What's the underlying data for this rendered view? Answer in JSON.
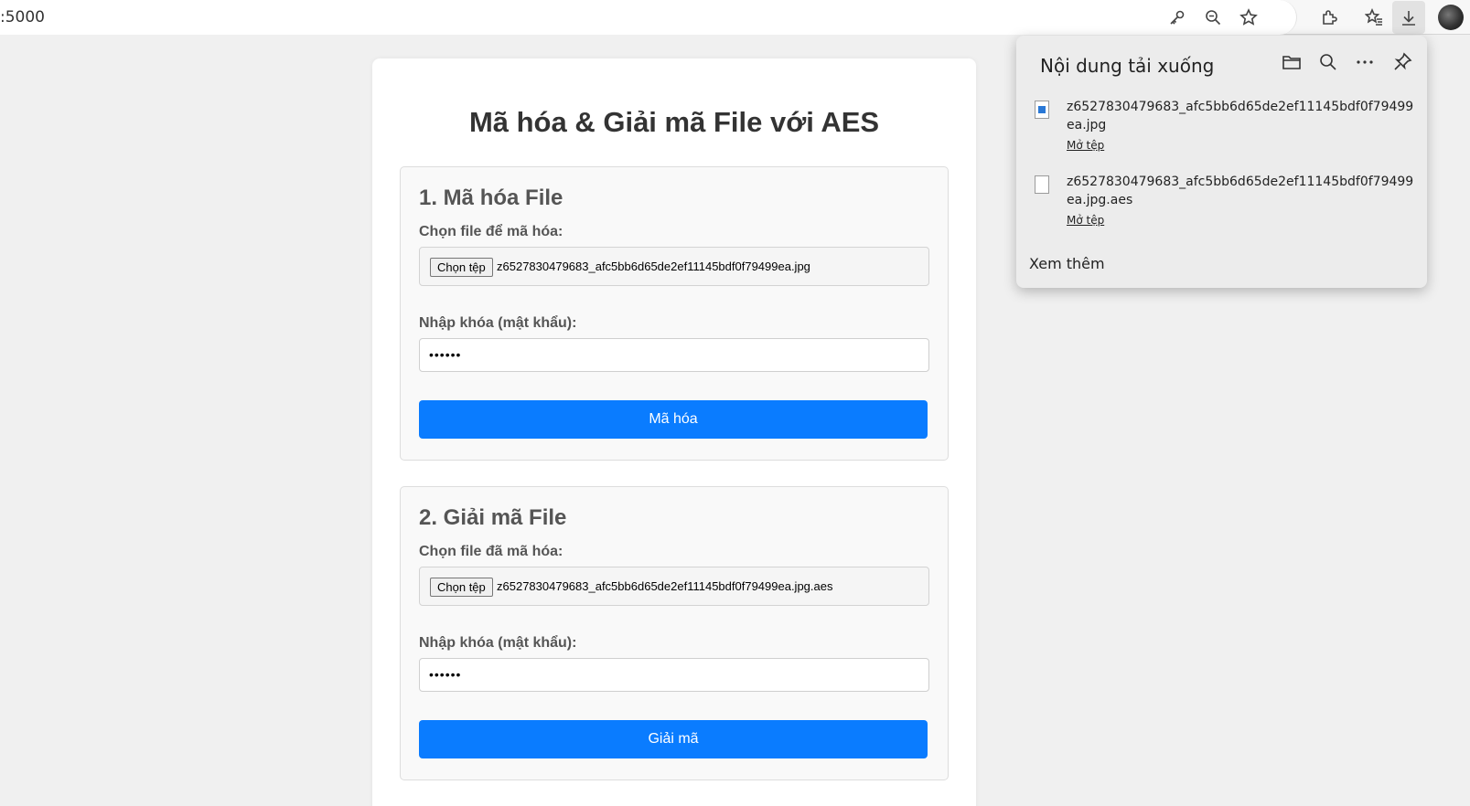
{
  "browser": {
    "url": ":5000",
    "icons": [
      "key-icon",
      "zoom-out-icon",
      "favorite-star-icon",
      "extensions-icon",
      "favorites-icon",
      "download-icon",
      "profile-avatar"
    ]
  },
  "page": {
    "title": "Mã hóa & Giải mã File với AES",
    "encrypt": {
      "heading": "1. Mã hóa File",
      "file_label": "Chọn file để mã hóa:",
      "file_button": "Chọn tệp",
      "file_name": "z6527830479683_afc5bb6d65de2ef11145bdf0f79499ea.jpg",
      "key_label": "Nhập khóa (mật khẩu):",
      "key_value": "••••••",
      "submit": "Mã hóa"
    },
    "decrypt": {
      "heading": "2. Giải mã File",
      "file_label": "Chọn file đã mã hóa:",
      "file_button": "Chọn tệp",
      "file_name": "z6527830479683_afc5bb6d65de2ef11145bdf0f79499ea.jpg.aes",
      "key_label": "Nhập khóa (mật khẩu):",
      "key_value": "••••••",
      "submit": "Giải mã"
    },
    "accent_color": "#0a7cff"
  },
  "downloads": {
    "title": "Nội dung tải xuống",
    "items": [
      {
        "name": "z6527830479683_afc5bb6d65de2ef11145bdf0f79499ea.jpg",
        "action": "Mở tệp",
        "icon": "image-file-icon"
      },
      {
        "name": "z6527830479683_afc5bb6d65de2ef11145bdf0f79499ea.jpg.aes",
        "action": "Mở tệp",
        "icon": "file-icon"
      }
    ],
    "see_more": "Xem thêm"
  }
}
